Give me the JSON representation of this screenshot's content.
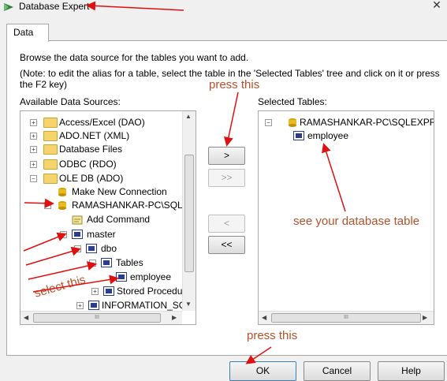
{
  "window": {
    "title": "Database Expert",
    "close_glyph": "✕"
  },
  "tab": {
    "label": "Data"
  },
  "instructions": {
    "line1": "Browse the data source for the tables you want to add.",
    "line2": "(Note: to edit the alias for a table, select the table in the 'Selected Tables' tree and click on it or press",
    "line3": "the F2 key)"
  },
  "available": {
    "label": "Available Data Sources:",
    "items": [
      {
        "text": "Access/Excel (DAO)",
        "icon": "folder-icon",
        "expander": "+"
      },
      {
        "text": "ADO.NET (XML)",
        "icon": "folder-icon",
        "expander": "+"
      },
      {
        "text": "Database Files",
        "icon": "folder-icon",
        "expander": "+"
      },
      {
        "text": "ODBC (RDO)",
        "icon": "folder-icon",
        "expander": "+"
      },
      {
        "text": "OLE DB (ADO)",
        "icon": "folder-icon",
        "expander": "-"
      },
      {
        "text": "Make New Connection",
        "icon": "new-connection-icon",
        "expander": ""
      },
      {
        "text": "RAMASHANKAR-PC\\SQLE",
        "icon": "database-server-icon",
        "expander": "-"
      },
      {
        "text": "Add Command",
        "icon": "command-icon",
        "expander": ""
      },
      {
        "text": "master",
        "icon": "database-icon",
        "expander": "-"
      },
      {
        "text": "dbo",
        "icon": "schema-icon",
        "expander": "-"
      },
      {
        "text": "Tables",
        "icon": "tables-icon",
        "expander": "-"
      },
      {
        "text": "employee",
        "icon": "table-icon",
        "expander": ""
      },
      {
        "text": "Stored Procedur",
        "icon": "procedure-icon",
        "expander": "+"
      },
      {
        "text": "INFORMATION_SCI",
        "icon": "schema-icon",
        "expander": "+"
      }
    ]
  },
  "selected": {
    "label": "Selected Tables:",
    "items": [
      {
        "text": "RAMASHANKAR-PC\\SQLEXPRES",
        "icon": "database-server-icon",
        "expander": "-"
      },
      {
        "text": "employee",
        "icon": "table-icon",
        "expander": ""
      }
    ]
  },
  "transfer_buttons": {
    "add": ">",
    "add_all": ">>",
    "remove": "<",
    "remove_all": "<<"
  },
  "scroll_glyphs": {
    "up": "▲",
    "down": "▼",
    "left": "◀",
    "right": "▶",
    "grip": "III"
  },
  "footer": {
    "ok": "OK",
    "cancel": "Cancel",
    "help": "Help"
  },
  "annotations": {
    "press_this_top": "press this",
    "see_table": "see your database table",
    "select_this": "select this",
    "press_this_bottom": "press this"
  },
  "colors": {
    "annotation_text": "#b5512b",
    "arrow": "#e01010",
    "selection": "#3399ff"
  }
}
